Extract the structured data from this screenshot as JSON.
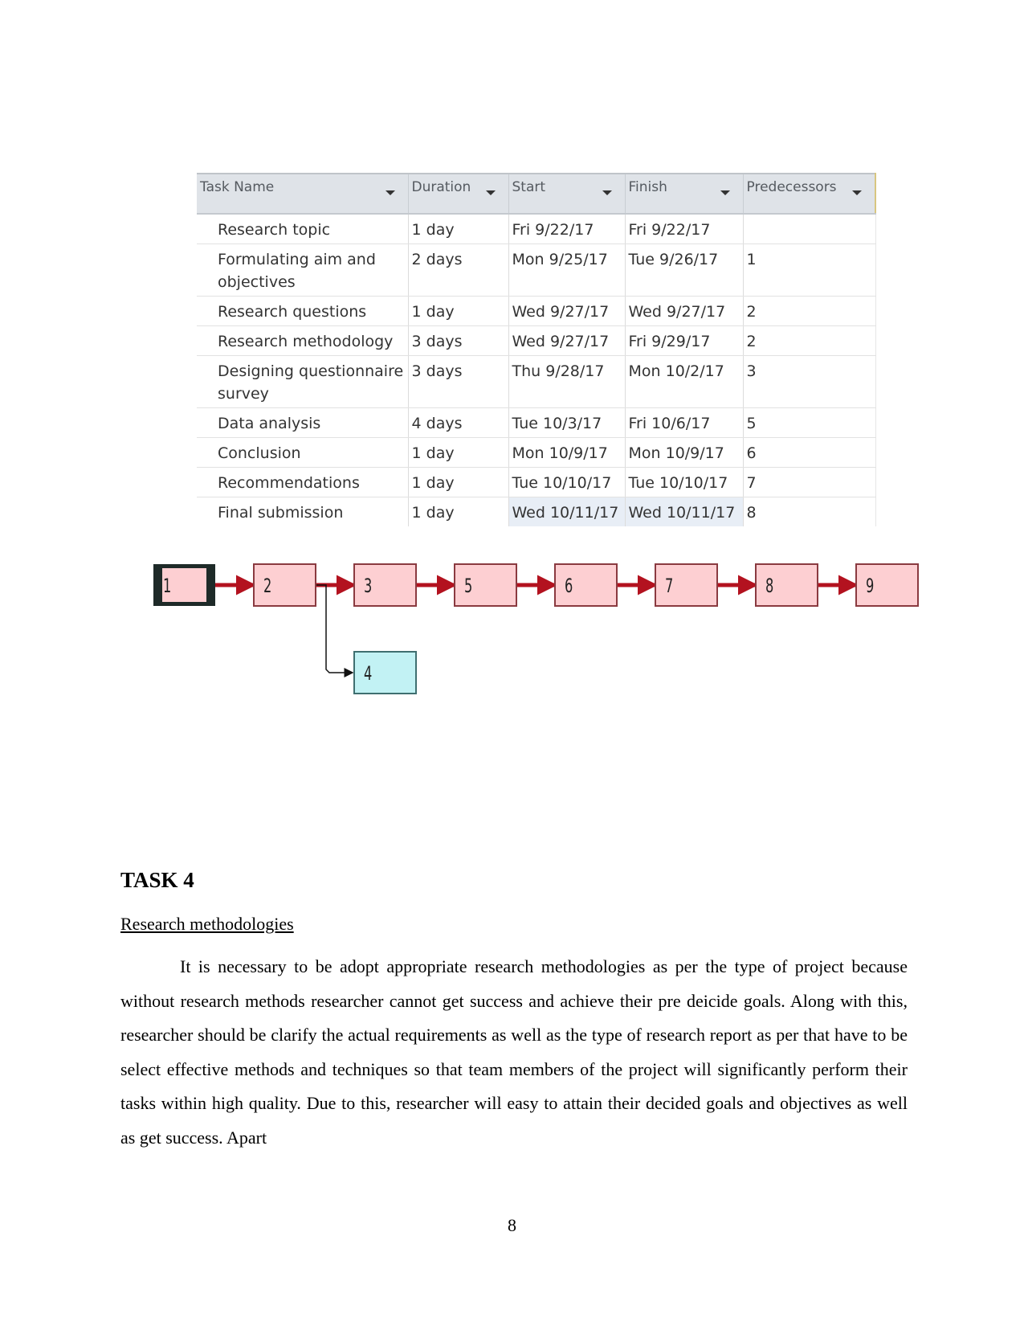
{
  "project_table": {
    "columns": [
      "Task Name",
      "Duration",
      "Start",
      "Finish",
      "Predecessors"
    ],
    "rows": [
      {
        "name": "Research topic",
        "duration": "1 day",
        "start": "Fri 9/22/17",
        "finish": "Fri 9/22/17",
        "predecessors": ""
      },
      {
        "name": "Formulating aim and objectives",
        "duration": "2 days",
        "start": "Mon 9/25/17",
        "finish": "Tue 9/26/17",
        "predecessors": "1"
      },
      {
        "name": "Research questions",
        "duration": "1 day",
        "start": "Wed 9/27/17",
        "finish": "Wed 9/27/17",
        "predecessors": "2"
      },
      {
        "name": "Research methodology",
        "duration": "3 days",
        "start": "Wed 9/27/17",
        "finish": "Fri 9/29/17",
        "predecessors": "2"
      },
      {
        "name": "Designing questionnaire survey",
        "duration": "3 days",
        "start": "Thu 9/28/17",
        "finish": "Mon 10/2/17",
        "predecessors": "3"
      },
      {
        "name": "Data analysis",
        "duration": "4 days",
        "start": "Tue 10/3/17",
        "finish": "Fri 10/6/17",
        "predecessors": "5"
      },
      {
        "name": "Conclusion",
        "duration": "1 day",
        "start": "Mon 10/9/17",
        "finish": "Mon 10/9/17",
        "predecessors": "6"
      },
      {
        "name": "Recommendations",
        "duration": "1 day",
        "start": "Tue 10/10/17",
        "finish": "Tue 10/10/17",
        "predecessors": "7"
      },
      {
        "name": "Final submission",
        "duration": "1 day",
        "start": "Wed 10/11/17",
        "finish": "Wed 10/11/17",
        "predecessors": "8"
      }
    ]
  },
  "network_diagram": {
    "critical_color": "#b3121f",
    "critical_fill": "#fdcfd2",
    "noncritical_fill": "#c2f2f4",
    "nodes": [
      {
        "id": "1",
        "critical": true,
        "selected": true
      },
      {
        "id": "2",
        "critical": true
      },
      {
        "id": "3",
        "critical": true
      },
      {
        "id": "5",
        "critical": true
      },
      {
        "id": "6",
        "critical": true
      },
      {
        "id": "7",
        "critical": true
      },
      {
        "id": "8",
        "critical": true
      },
      {
        "id": "9",
        "critical": true
      },
      {
        "id": "4",
        "critical": false
      }
    ],
    "links": [
      {
        "from": "1",
        "to": "2",
        "critical": true
      },
      {
        "from": "2",
        "to": "3",
        "critical": true
      },
      {
        "from": "3",
        "to": "5",
        "critical": true
      },
      {
        "from": "5",
        "to": "6",
        "critical": true
      },
      {
        "from": "6",
        "to": "7",
        "critical": true
      },
      {
        "from": "7",
        "to": "8",
        "critical": true
      },
      {
        "from": "8",
        "to": "9",
        "critical": true
      },
      {
        "from": "2",
        "to": "4",
        "critical": false
      }
    ]
  },
  "document": {
    "task_heading": "TASK 4",
    "section_title": "Research methodologies",
    "paragraph": "It is necessary to be adopt appropriate research methodologies as per the type of project because without research methods researcher cannot get success and achieve their pre deicide goals. Along with this, researcher should be clarify the actual requirements as well as the type of research report as per that have to be select effective methods and techniques so that team members of the project will significantly perform their tasks within high quality. Due to this, researcher will easy to attain their decided goals and objectives as well as get success. Apart",
    "page_number": "8"
  }
}
